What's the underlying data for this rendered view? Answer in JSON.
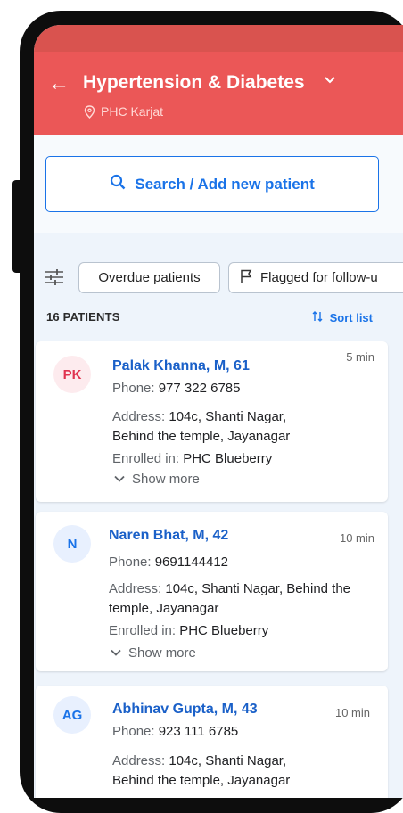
{
  "header": {
    "title": "Hypertension & Diabetes",
    "facility": "PHC Karjat"
  },
  "search": {
    "label": "Search / Add new patient"
  },
  "filters": {
    "overdue_label": "Overdue patients",
    "flagged_label": "Flagged for follow-u"
  },
  "list": {
    "count_label": "16 PATIENTS",
    "sort_label": "Sort list"
  },
  "patients": [
    {
      "initials": "PK",
      "name": "Palak Khanna, M, 61",
      "time": "5 min",
      "phone_label": "Phone:",
      "phone": "977 322 6785",
      "address_label": "Address:",
      "address_line1": "104c, Shanti Nagar,",
      "address_line2": "Behind the temple, Jayanagar",
      "enrolled_label": "Enrolled in:",
      "enrolled": "PHC Blueberry",
      "show_more": "Show more"
    },
    {
      "initials": "N",
      "name": "Naren Bhat, M, 42",
      "time": "10 min",
      "phone_label": "Phone:",
      "phone": "9691144412",
      "address_label": "Address:",
      "address_line1": "104c, Shanti Nagar, Behind the",
      "address_line2": "temple, Jayanagar",
      "enrolled_label": "Enrolled in:",
      "enrolled": "PHC Blueberry",
      "show_more": "Show more"
    },
    {
      "initials": "AG",
      "name": "Abhinav Gupta, M, 43",
      "time": "10 min",
      "phone_label": "Phone:",
      "phone": "923 111 6785",
      "address_label": "Address:",
      "address_line1": "104c, Shanti Nagar,",
      "address_line2": "Behind the temple, Jayanagar"
    }
  ],
  "icons": {
    "back": "arrow-left-icon",
    "dropdown": "chevron-down-icon",
    "location": "location-pin-icon",
    "search": "search-icon",
    "filter": "filter-sliders-icon",
    "flag": "flag-icon",
    "sort": "sort-icon",
    "expand": "chevron-down-icon"
  },
  "colors": {
    "app_bar": "#eb5757",
    "status_bar": "#d9534f",
    "primary": "#1a73e8",
    "avatar_pink": "#e0334f"
  }
}
